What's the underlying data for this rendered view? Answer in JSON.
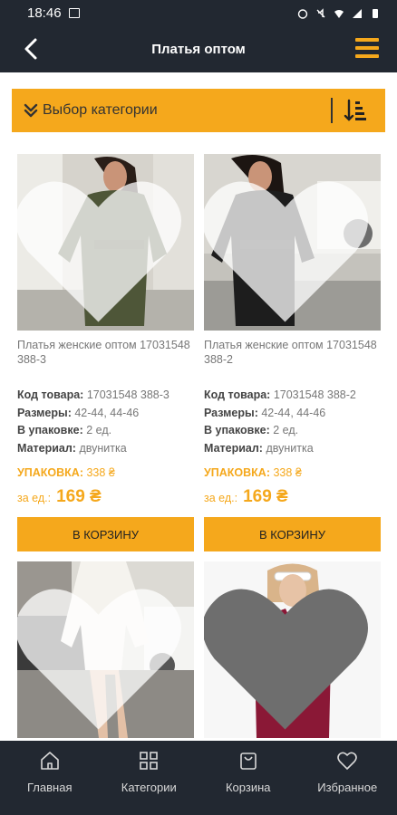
{
  "status": {
    "time": "18:46"
  },
  "header": {
    "title": "Платья оптом"
  },
  "category": {
    "label": "Выбор категории"
  },
  "labels": {
    "code": "Код товара:",
    "sizes": "Размеры:",
    "pack_count": "В упаковке:",
    "material": "Материал:",
    "pack_price": "УПАКОВКА:",
    "unit_price": "за ед.:",
    "cart_button": "В КОРЗИНУ"
  },
  "products": [
    {
      "name": "Платья женские оптом 17031548  388-3",
      "code": "17031548  388-3",
      "sizes": "42-44, 44-46",
      "pack_count": "2 ед.",
      "material": "двунитка",
      "pack_price": "338 ₴",
      "unit_price": "169 ₴"
    },
    {
      "name": "Платья женские оптом 17031548  388-2",
      "code": "17031548  388-2",
      "sizes": "42-44, 44-46",
      "pack_count": "2 ед.",
      "material": "двунитка",
      "pack_price": "338 ₴",
      "unit_price": "169 ₴"
    }
  ],
  "nav": {
    "home": "Главная",
    "categories": "Категории",
    "cart": "Корзина",
    "favorites": "Избранное"
  },
  "colors": {
    "accent": "#f5a81c",
    "dark": "#222831"
  }
}
